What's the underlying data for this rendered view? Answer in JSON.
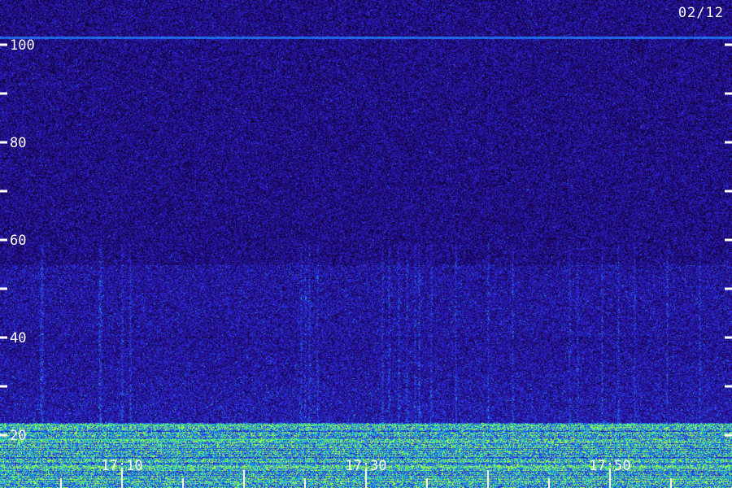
{
  "chart_data": {
    "type": "heatmap",
    "title": "",
    "date": "02/12",
    "xlabel": "",
    "ylabel": "",
    "x_tick_labels": [
      "17:10",
      "17:30",
      "17:50"
    ],
    "y_tick_labels": [
      "20",
      "40",
      "60",
      "80",
      "100"
    ],
    "y_range_khz": [
      16,
      105
    ],
    "x_range": [
      "17:05",
      "17:65"
    ],
    "colormap": [
      "#000000",
      "#1a0d4a",
      "#2d1aa0",
      "#2e4fe8",
      "#1fb7e6",
      "#26e39a",
      "#b0ff40"
    ],
    "features": {
      "carrier_line_khz": 101.5,
      "emission_band_khz": [
        40,
        55
      ],
      "strong_band_khz": [
        16,
        22.5
      ],
      "carrier_20_khz": 22.2
    }
  }
}
